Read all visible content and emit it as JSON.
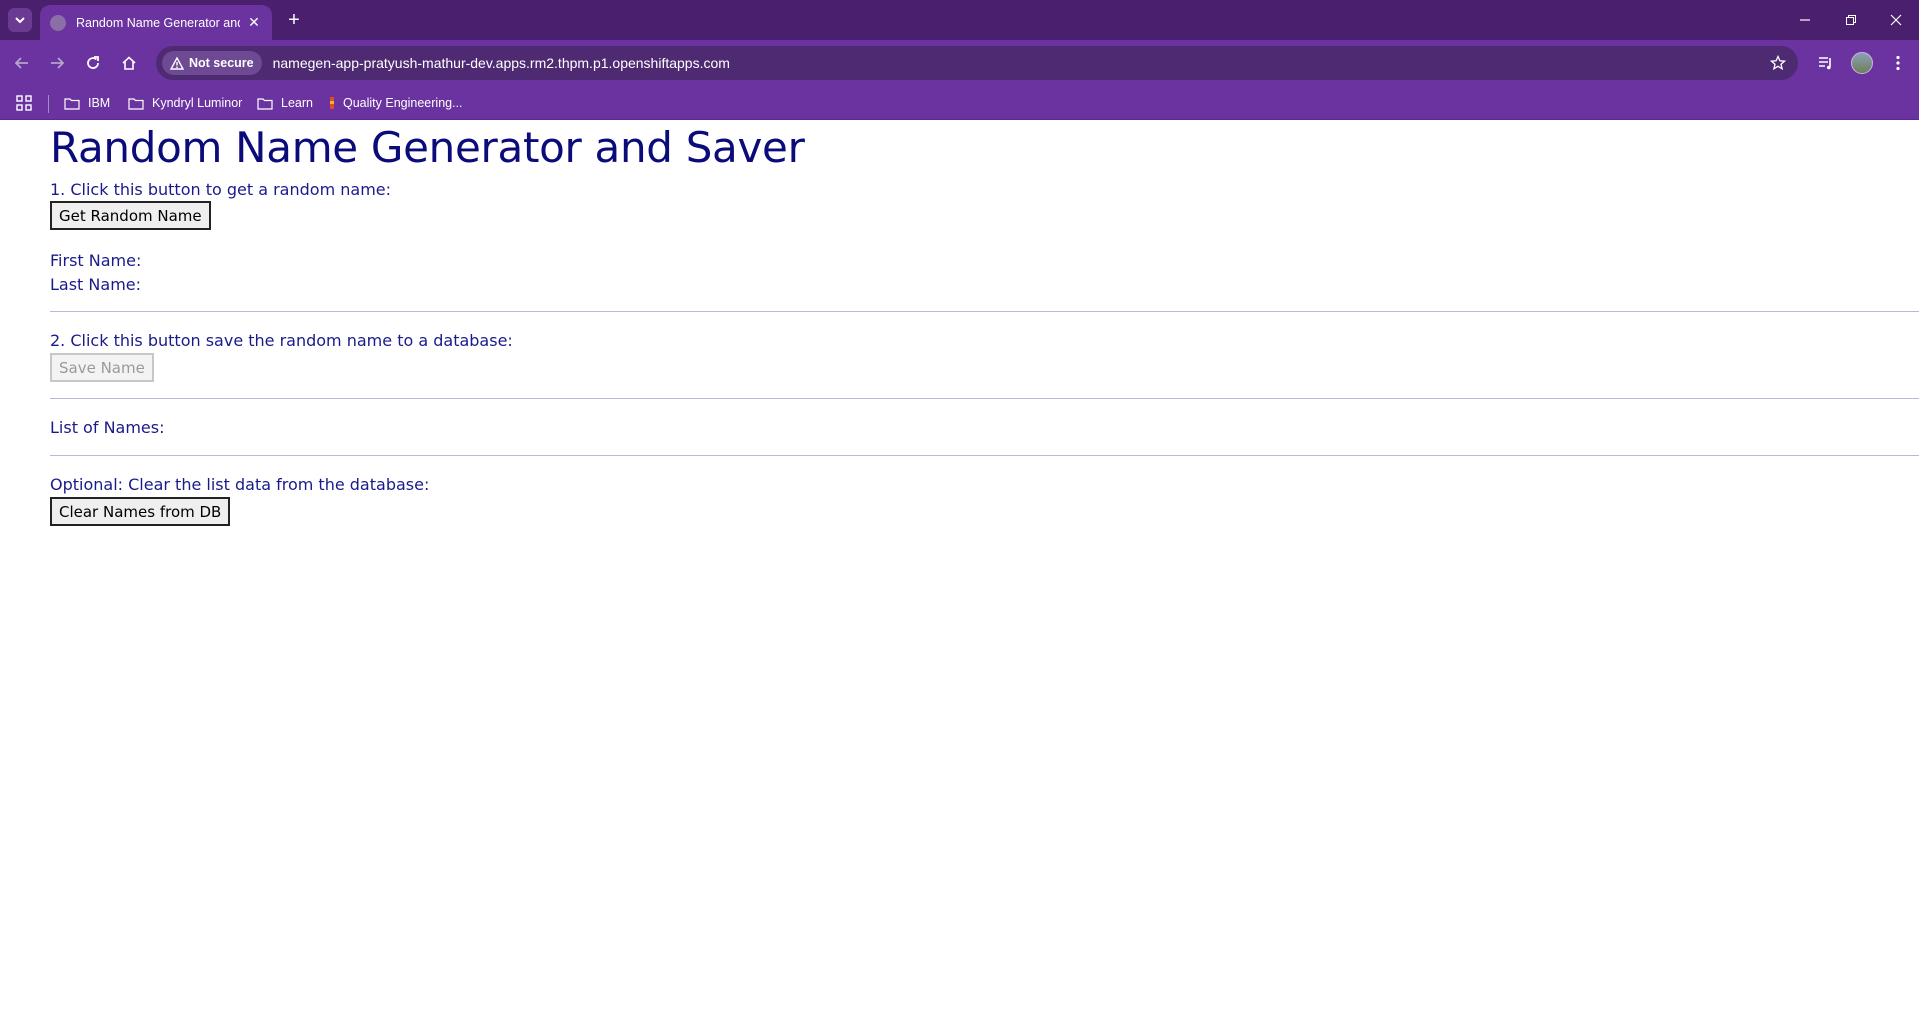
{
  "browser": {
    "tab": {
      "title": "Random Name Generator and Saver"
    },
    "address": {
      "security_label": "Not secure",
      "url": "namegen-app-pratyush-mathur-dev.apps.rm2.thpm.p1.openshiftapps.com"
    },
    "bookmarks": [
      {
        "label": "IBM",
        "icon": "folder-icon"
      },
      {
        "label": "Kyndryl Luminor",
        "icon": "folder-icon"
      },
      {
        "label": "Learn",
        "icon": "folder-icon"
      },
      {
        "label": "Quality Engineering...",
        "icon": "bookmark-favicon"
      }
    ]
  },
  "page": {
    "title": "Random Name Generator and Saver",
    "step1": {
      "instruction": "1. Click this button to get a random name:",
      "button": "Get Random Name"
    },
    "first_name_label": "First Name:",
    "last_name_label": "Last Name:",
    "step2": {
      "instruction": "2. Click this button save the random name to a database:",
      "button": "Save Name"
    },
    "list_label": "List of Names:",
    "optional": {
      "instruction": "Optional: Clear the list data from the database:",
      "button": "Clear Names from DB"
    }
  },
  "colors": {
    "tabbar": "#4a1f6e",
    "toolbar": "#6a33a0",
    "text_navy": "#1a1a8c"
  }
}
